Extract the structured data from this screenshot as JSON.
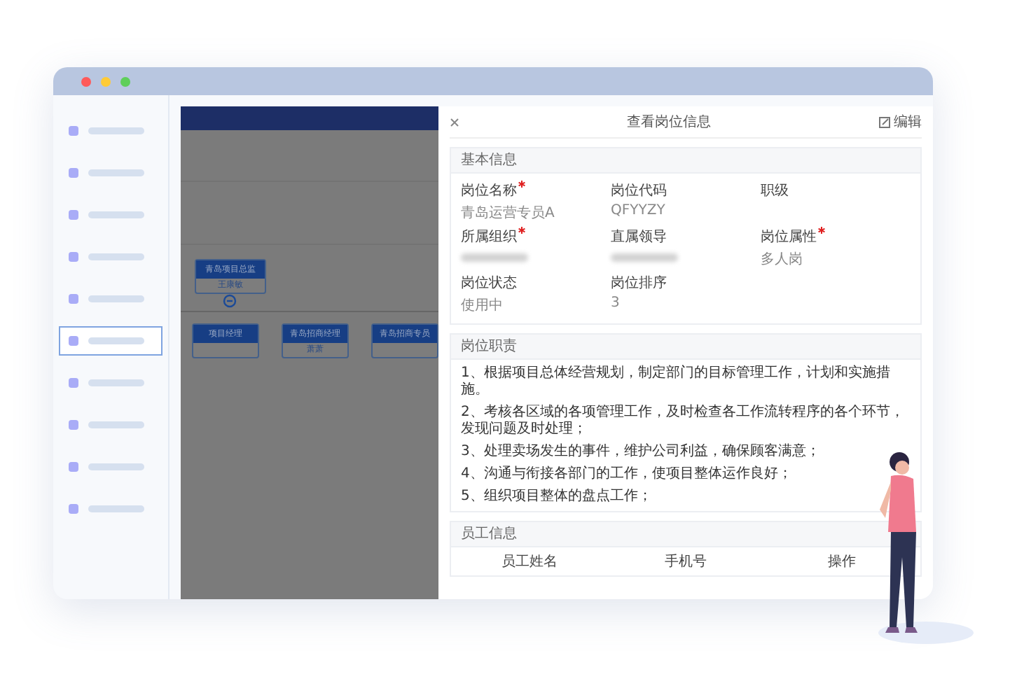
{
  "sidebar": {
    "items": [
      {
        "selected": false
      },
      {
        "selected": false
      },
      {
        "selected": false
      },
      {
        "selected": false
      },
      {
        "selected": false
      },
      {
        "selected": true
      },
      {
        "selected": false
      },
      {
        "selected": false
      },
      {
        "selected": false
      },
      {
        "selected": false
      }
    ]
  },
  "org_chart": {
    "root": {
      "title": "青岛项目总监",
      "name": "王康敏"
    },
    "children": [
      {
        "title": "项目经理"
      },
      {
        "title": "青岛招商经理",
        "name": "萧萧"
      },
      {
        "title": "青岛招商专员"
      }
    ]
  },
  "drawer": {
    "title": "查看岗位信息",
    "edit_label": "编辑",
    "basic": {
      "heading": "基本信息",
      "fields": [
        {
          "label": "岗位名称",
          "required": true,
          "value": "青岛运营专员A"
        },
        {
          "label": "岗位代码",
          "required": false,
          "value": "QFYYZY"
        },
        {
          "label": "职级",
          "required": false
        },
        {
          "label": "所属组织",
          "required": true,
          "blurred": true
        },
        {
          "label": "直属领导",
          "required": false,
          "blurred": true
        },
        {
          "label": "岗位属性",
          "required": true,
          "value": "多人岗"
        },
        {
          "label": "岗位状态",
          "required": false,
          "value": "使用中"
        },
        {
          "label": "岗位排序",
          "required": false,
          "value": "3"
        }
      ]
    },
    "duties": {
      "heading": "岗位职责",
      "items": [
        "1、根据项目总体经营规划，制定部门的目标管理工作，计划和实施措施。",
        "2、考核各区域的各项管理工作，及时检查各工作流转程序的各个环节，发现问题及时处理；",
        "3、处理卖场发生的事件，维护公司利益，确保顾客满意；",
        "4、沟通与衔接各部门的工作，使项目整体运作良好；",
        "5、组织项目整体的盘点工作；"
      ]
    },
    "staff": {
      "heading": "员工信息",
      "columns": [
        "员工姓名",
        "手机号",
        "操作"
      ]
    }
  }
}
